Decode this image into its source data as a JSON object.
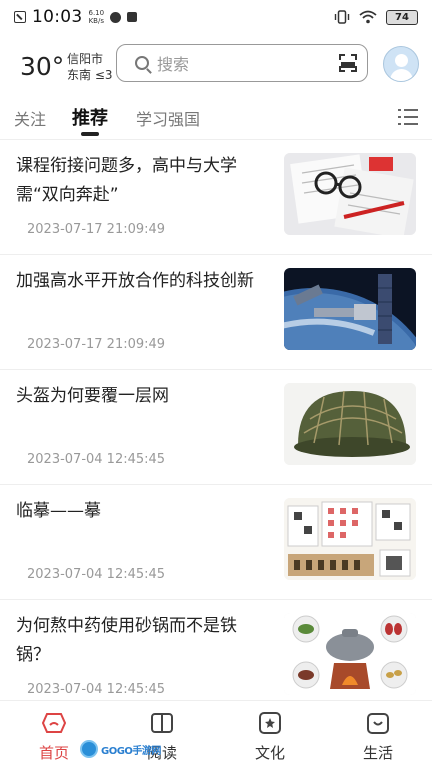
{
  "status_bar": {
    "time": "10:03",
    "net_speed_value": "6.10",
    "net_speed_unit": "KB/s",
    "battery": "74"
  },
  "header": {
    "temperature": "30°",
    "city": "信阳市",
    "wind": "东南 ≤3",
    "search_placeholder": "搜索"
  },
  "tabs": [
    {
      "label": "关注",
      "active": false
    },
    {
      "label": "推荐",
      "active": true
    },
    {
      "label": "学习强国",
      "active": false
    }
  ],
  "news": [
    {
      "title": "课程衔接问题多，高中与大学需“双向奔赴”",
      "date": "2023-07-17 21:09:49",
      "thumb": "glasses-papers-photo"
    },
    {
      "title": "加强高水平开放合作的科技创新",
      "date": "2023-07-17 21:09:49",
      "thumb": "space-station-photo"
    },
    {
      "title": "头盔为何要覆一层网",
      "date": "2023-07-04 12:45:45",
      "thumb": "netted-helmet-photo"
    },
    {
      "title": "临摹——摹",
      "date": "2023-07-04 12:45:45",
      "thumb": "calligraphy-copybook-photo"
    },
    {
      "title": "为何熬中药使用砂锅而不是铁锅？",
      "date": "2023-07-04 12:45:45",
      "thumb": "herbal-pot-illustration"
    }
  ],
  "bottom_nav": [
    {
      "label": "首页",
      "icon": "home-icon",
      "active": true
    },
    {
      "label": "阅读",
      "icon": "book-icon",
      "active": false
    },
    {
      "label": "文化",
      "icon": "star-box-icon",
      "active": false
    },
    {
      "label": "生活",
      "icon": "smile-bag-icon",
      "active": false
    }
  ],
  "watermark": {
    "text": "GOGO手游网"
  },
  "colors": {
    "accent_red": "#d44444",
    "text_primary": "#222222",
    "text_muted": "#999999"
  }
}
